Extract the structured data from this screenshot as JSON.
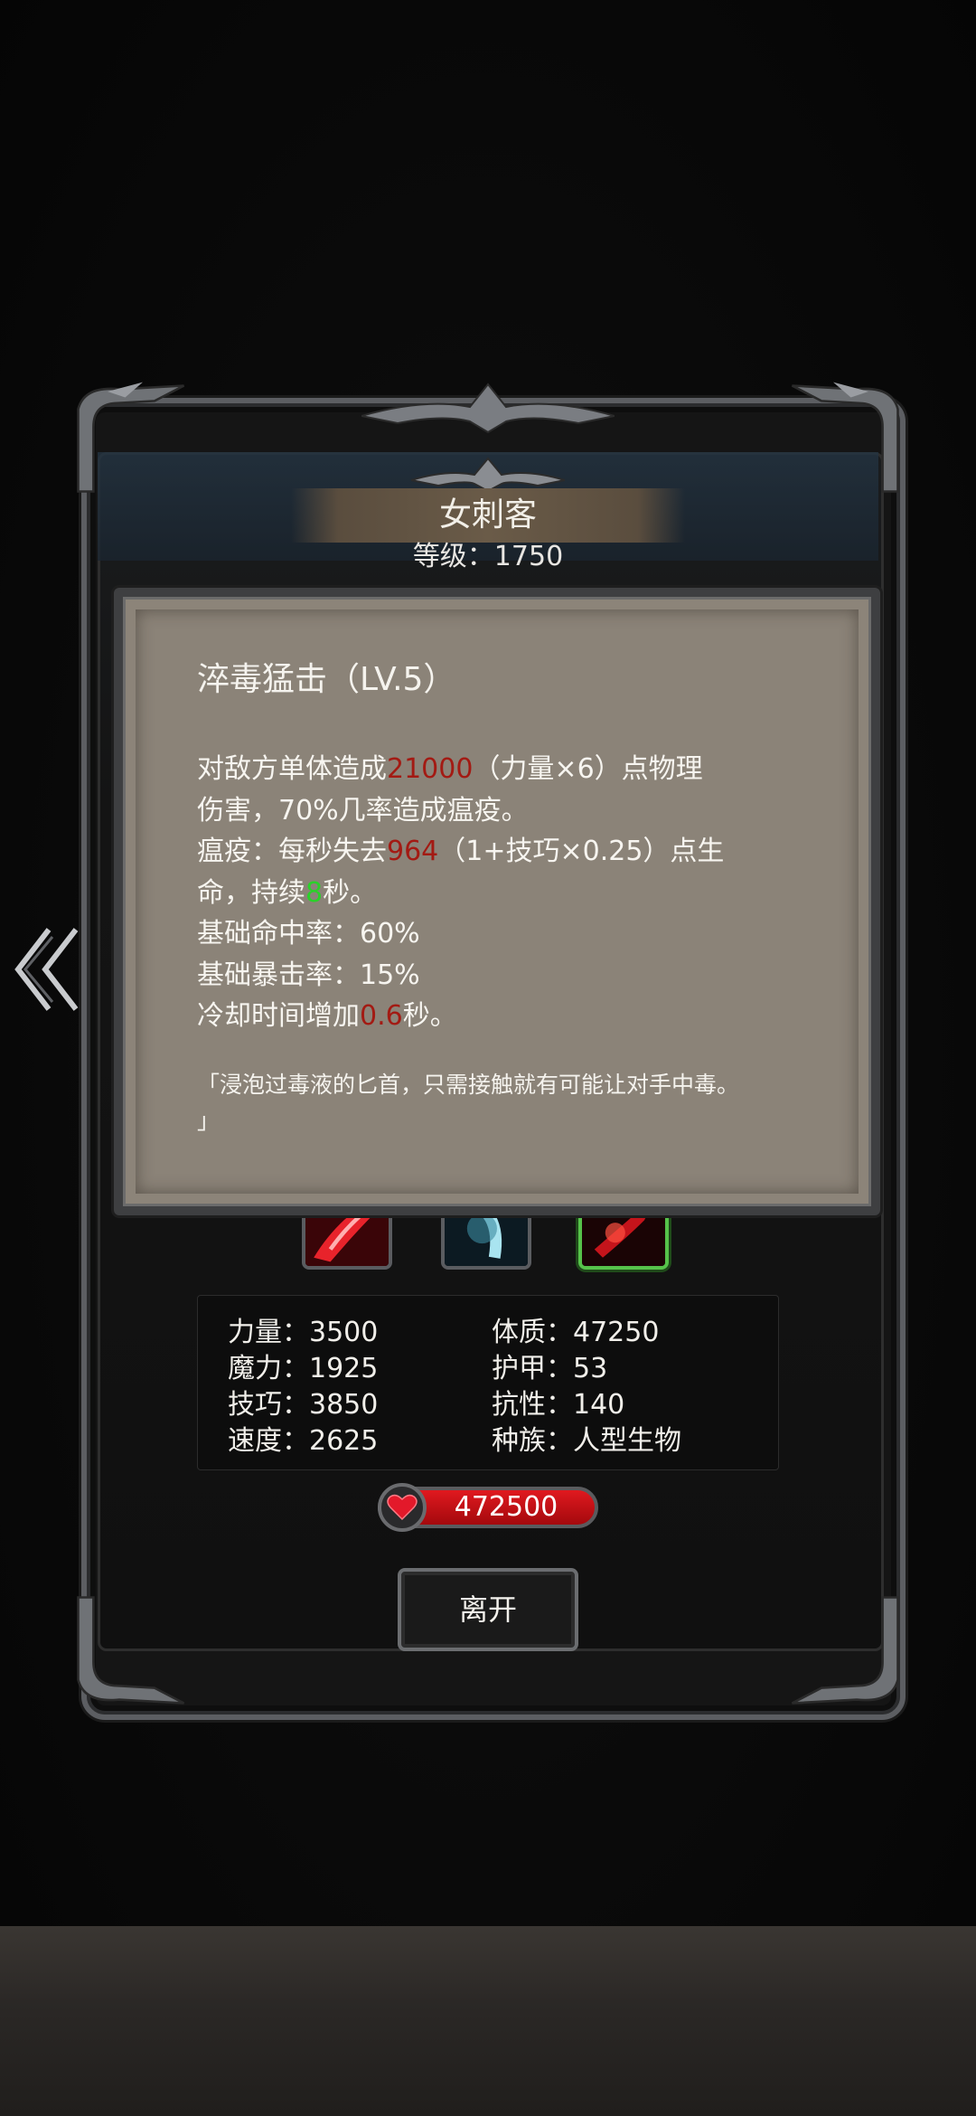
{
  "character": {
    "name": "女刺客",
    "level_text": "等级：1750"
  },
  "skill": {
    "title": "淬毒猛击（LV.5）",
    "lines": [
      [
        "对敌方单体造成",
        "21000",
        "（力量×6）点物理"
      ],
      [
        "伤害，70%几率造成瘟疫。"
      ],
      [
        "瘟疫：每秒失去",
        "964",
        "（1+技巧×0.25）点生"
      ],
      [
        "命，持续",
        "8",
        "秒。"
      ],
      [
        "基础命中率：60%"
      ],
      [
        "基础暴击率：15%"
      ],
      [
        "冷却时间增加",
        "0.6",
        "秒。"
      ]
    ],
    "flavor_line1": "「浸泡过毒液的匕首，只需接触就有可能让对手中毒。",
    "flavor_line2": "」"
  },
  "skill_icons": [
    {
      "name": "skill-icon-1",
      "selected": false
    },
    {
      "name": "skill-icon-2",
      "selected": false
    },
    {
      "name": "skill-icon-3",
      "selected": true
    }
  ],
  "stats": {
    "left": [
      "力量：3500",
      "魔力：1925",
      "技巧：3850",
      "速度：2625"
    ],
    "right": [
      "体质：47250",
      "护甲：53",
      "抗性：140",
      "种族：人型生物"
    ]
  },
  "hp": {
    "value": "472500",
    "icon": "heart-icon"
  },
  "buttons": {
    "leave": "离开",
    "back_icon": "double-chevron-left-icon"
  },
  "colors": {
    "highlight_red": "#a31a13",
    "highlight_green": "#2ad12a",
    "panel": "#8c8479",
    "hp_bar": "#d2141a"
  }
}
